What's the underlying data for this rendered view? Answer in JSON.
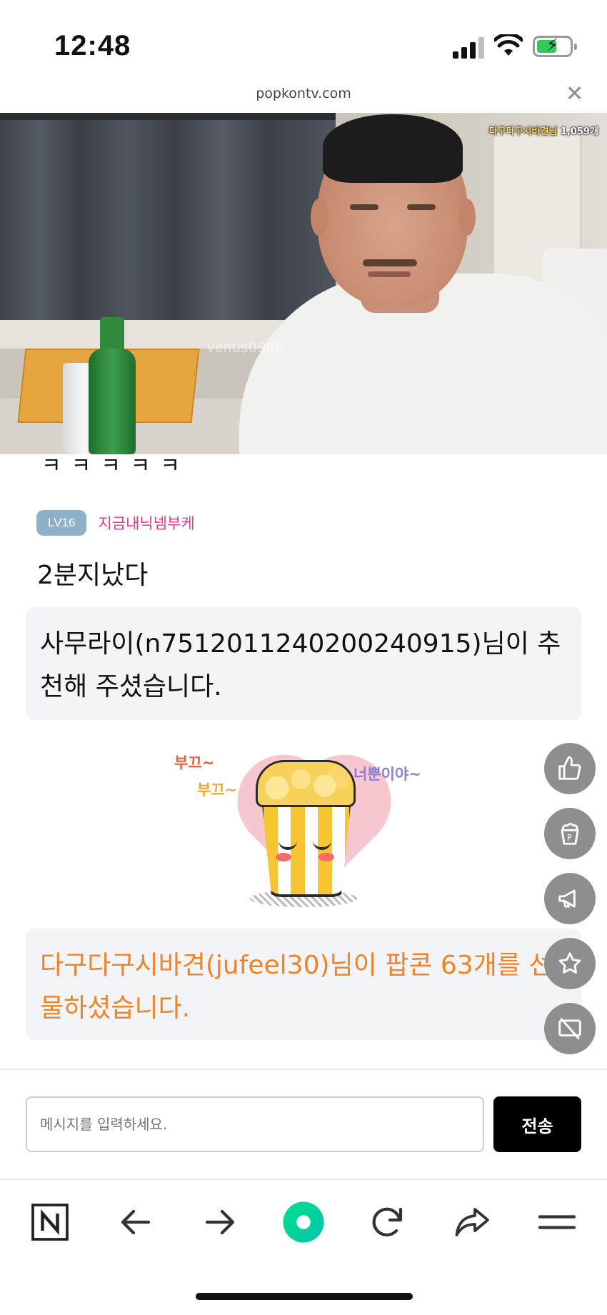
{
  "status_bar": {
    "time": "12:48"
  },
  "url_bar": {
    "url": "popkontv.com",
    "close_icon": "close-icon"
  },
  "video": {
    "notice_name": "다구다구시바견님",
    "notice_count": "1,059개",
    "watermark": "venus0988"
  },
  "chat": {
    "partial_text": "ㅋㅋㅋㅋㅋ",
    "message": {
      "level": "LV16",
      "nickname": "지금내닉넴부케",
      "text": "2분지났다"
    },
    "recommend_notice": "사무라이(n7512011240200240915)님이 추천해 주셨습니다.",
    "sticker": {
      "text_1": "부끄~",
      "text_2": "부끄~",
      "text_3": "너뿐이야~"
    },
    "gift_notice": "다구다구시바견(jufeel30)님이 팝콘 63개를 선물하셨습니다.",
    "colors": {
      "nickname": "#e8398a",
      "gift": "#f08326",
      "level_badge": "#8fb0c9"
    }
  },
  "side_actions": [
    "thumbs-up-icon",
    "popcorn-icon",
    "megaphone-icon",
    "star-icon",
    "screen-off-icon"
  ],
  "input": {
    "placeholder": "메시지를 입력하세요.",
    "send_label": "전송"
  },
  "nav": [
    "naver-n-icon",
    "back-arrow-icon",
    "forward-arrow-icon",
    "green-home-icon",
    "refresh-icon",
    "share-icon",
    "menu-icon"
  ]
}
